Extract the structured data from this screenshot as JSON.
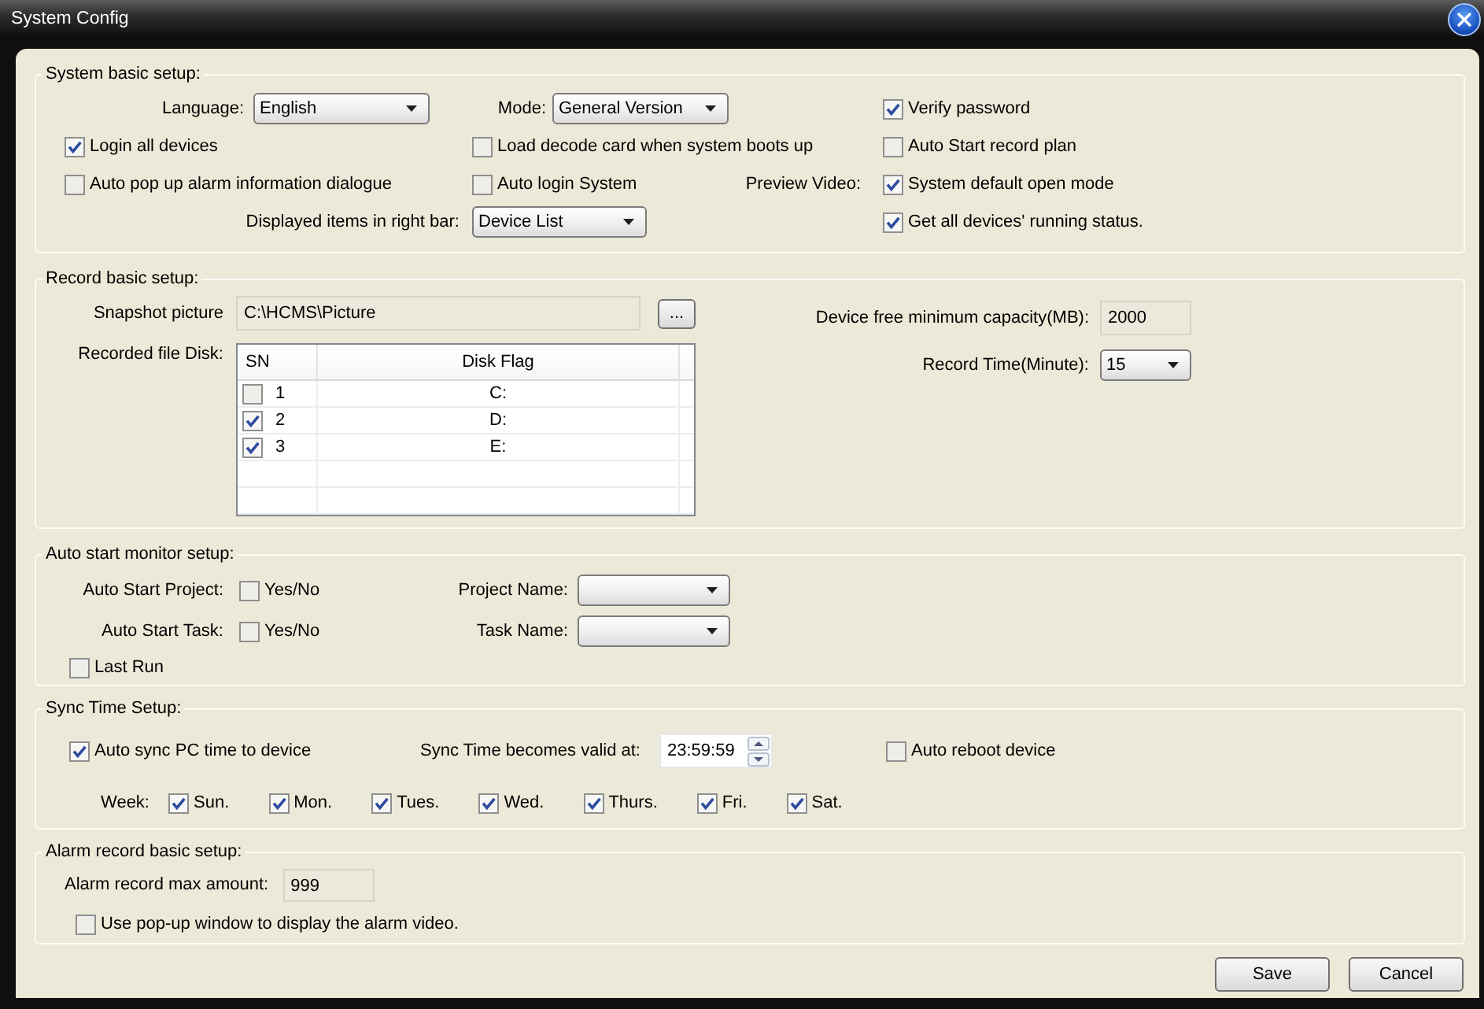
{
  "window": {
    "title": "System Config"
  },
  "system_basic_setup": {
    "title": "System basic setup:",
    "language": {
      "label": "Language:",
      "value": "English"
    },
    "mode": {
      "label": "Mode:",
      "value": "General Version"
    },
    "verify_password": {
      "label": "Verify password",
      "checked": true
    },
    "login_all_devices": {
      "label": "Login all devices",
      "checked": true
    },
    "load_decode_card": {
      "label": "Load decode card when system boots up",
      "checked": false
    },
    "auto_start_record_plan": {
      "label": "Auto Start record plan",
      "checked": false
    },
    "auto_pop_up_alarm": {
      "label": "Auto pop up alarm information dialogue",
      "checked": false
    },
    "auto_login_system": {
      "label": "Auto login System",
      "checked": false
    },
    "preview_video_label": "Preview Video:",
    "system_default_open_mode": {
      "label": "System default open mode",
      "checked": true
    },
    "displayed_items": {
      "label": "Displayed items in right bar:",
      "value": "Device List"
    },
    "get_all_devices_status": {
      "label": "Get all devices' running status.",
      "checked": true
    }
  },
  "record_basic_setup": {
    "title": "Record basic setup:",
    "snapshot_picture": {
      "label": "Snapshot picture",
      "value": "C:\\HCMS\\Picture",
      "browse_button": "..."
    },
    "device_free_minimum_capacity": {
      "label": "Device free minimum capacity(MB):",
      "value": "2000"
    },
    "recorded_file_disk": {
      "label": "Recorded file Disk:",
      "columns": [
        "SN",
        "Disk Flag"
      ],
      "rows": [
        {
          "sn": "1",
          "disk_flag": "C:",
          "checked": false
        },
        {
          "sn": "2",
          "disk_flag": "D:",
          "checked": true
        },
        {
          "sn": "3",
          "disk_flag": "E:",
          "checked": true
        }
      ]
    },
    "record_time": {
      "label": "Record Time(Minute):",
      "value": "15"
    }
  },
  "auto_start_monitor_setup": {
    "title": "Auto start monitor setup:",
    "auto_start_project": {
      "label": "Auto Start Project:",
      "option": "Yes/No",
      "checked": false
    },
    "project_name": {
      "label": "Project Name:"
    },
    "auto_start_task": {
      "label": "Auto Start Task:",
      "option": "Yes/No",
      "checked": false
    },
    "task_name": {
      "label": "Task Name:"
    },
    "last_run": {
      "label": "Last Run",
      "checked": false
    }
  },
  "sync_time_setup": {
    "title": "Sync Time Setup:",
    "auto_sync": {
      "label": "Auto sync PC time to device",
      "checked": true
    },
    "valid_at": {
      "label": "Sync Time becomes valid at:",
      "value": "23:59:59"
    },
    "auto_reboot": {
      "label": "Auto reboot device",
      "checked": false
    },
    "week": {
      "label": "Week:",
      "days": [
        {
          "label": "Sun.",
          "checked": true
        },
        {
          "label": "Mon.",
          "checked": true
        },
        {
          "label": "Tues.",
          "checked": true
        },
        {
          "label": "Wed.",
          "checked": true
        },
        {
          "label": "Thurs.",
          "checked": true
        },
        {
          "label": "Fri.",
          "checked": true
        },
        {
          "label": "Sat.",
          "checked": true
        }
      ]
    }
  },
  "alarm_record_basic_setup": {
    "title": "Alarm record basic setup:",
    "max_amount": {
      "label": "Alarm record max amount:",
      "value": "999"
    },
    "popup_window": {
      "label": "Use pop-up window to display the alarm video.",
      "checked": false
    }
  },
  "buttons": [
    "Save",
    "Cancel"
  ]
}
